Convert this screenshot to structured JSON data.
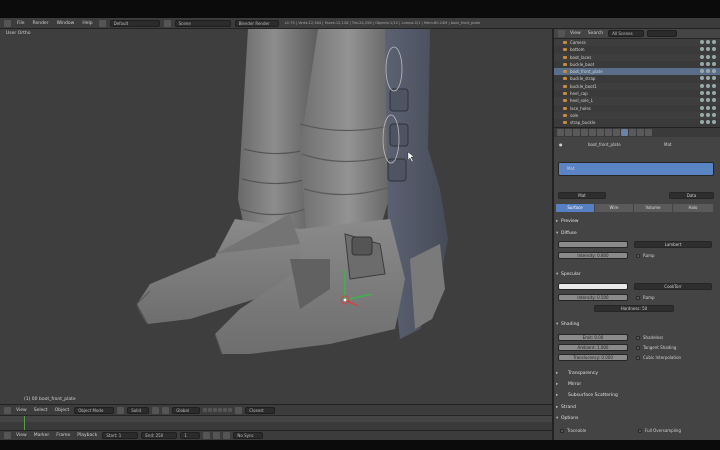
{
  "info_header": {
    "menus": [
      "File",
      "Render",
      "Window",
      "Help"
    ],
    "screen_layout": "Default",
    "scene": "Scene",
    "render_engine": "Blender Render",
    "stats": "v2.79 | Verts:12,384 | Faces:12,128 | Tris:24,256 | Objects:1/12 | Lamps:0/1 | Mem:60.24M | boot_front_plate"
  },
  "viewport": {
    "view_label": "User Ortho",
    "object_label": "(1) 00 boot_front_plate"
  },
  "viewport_header": {
    "menus": [
      "View",
      "Select",
      "Object"
    ],
    "mode": "Object Mode",
    "shading": "Solid",
    "pivot": "Global",
    "snap": "Closest"
  },
  "timeline": {
    "menus": [
      "View",
      "Marker",
      "Frame",
      "Playback"
    ],
    "start": "Start: 1",
    "end": "End: 250",
    "current": "1",
    "sync": "No Sync"
  },
  "outliner": {
    "menus": [
      "View",
      "Search",
      "All Scenes"
    ],
    "rows": [
      {
        "name": "Camera",
        "selected": false
      },
      {
        "name": "bottom",
        "selected": false
      },
      {
        "name": "boot_laces",
        "selected": false
      },
      {
        "name": "buckle_boot",
        "selected": false
      },
      {
        "name": "boot_front_plate",
        "selected": true
      },
      {
        "name": "buckle_strap",
        "selected": false
      },
      {
        "name": "buckle_boot1",
        "selected": false
      },
      {
        "name": "heel_cap",
        "selected": false
      },
      {
        "name": "heel_sole_L",
        "selected": false
      },
      {
        "name": "lace_holes",
        "selected": false
      },
      {
        "name": "sole",
        "selected": false
      },
      {
        "name": "strap_buckle",
        "selected": false
      },
      {
        "name": "toe_cap",
        "selected": false
      }
    ]
  },
  "properties": {
    "breadcrumb": "boot_front_plate",
    "material_slot": "Mat",
    "material_name": "Mat",
    "data_label": "Data",
    "tabs": [
      "Surface",
      "Wire",
      "Volume",
      "Halo"
    ],
    "panels": {
      "preview": "Preview",
      "diffuse": "Diffuse",
      "diffuse_shader": "Lambert",
      "intensity": "Intensity: 0.800",
      "ramp": "Ramp",
      "specular": "Specular",
      "specular_shader": "CookTorr",
      "spec_intensity": "Intensity: 0.500",
      "hardness": "Hardness: 50",
      "shading": "Shading",
      "emit": "Emit: 0.00",
      "ambient": "Ambient: 1.000",
      "translucency": "Translucency: 0.000",
      "shadeless": "Shadeless",
      "tangent_shading": "Tangent Shading",
      "cubic": "Cubic Interpolation",
      "transparency": "Transparency",
      "mirror": "Mirror",
      "sss": "Subsurface Scattering",
      "strand": "Strand",
      "options": "Options",
      "traceable": "Traceable",
      "full_oversampling": "Full Oversampling"
    }
  },
  "colors": {
    "viewport_bg": "#3e3e3e",
    "accent_blue": "#5680c2",
    "outliner_selected": "#5a6e8a"
  }
}
